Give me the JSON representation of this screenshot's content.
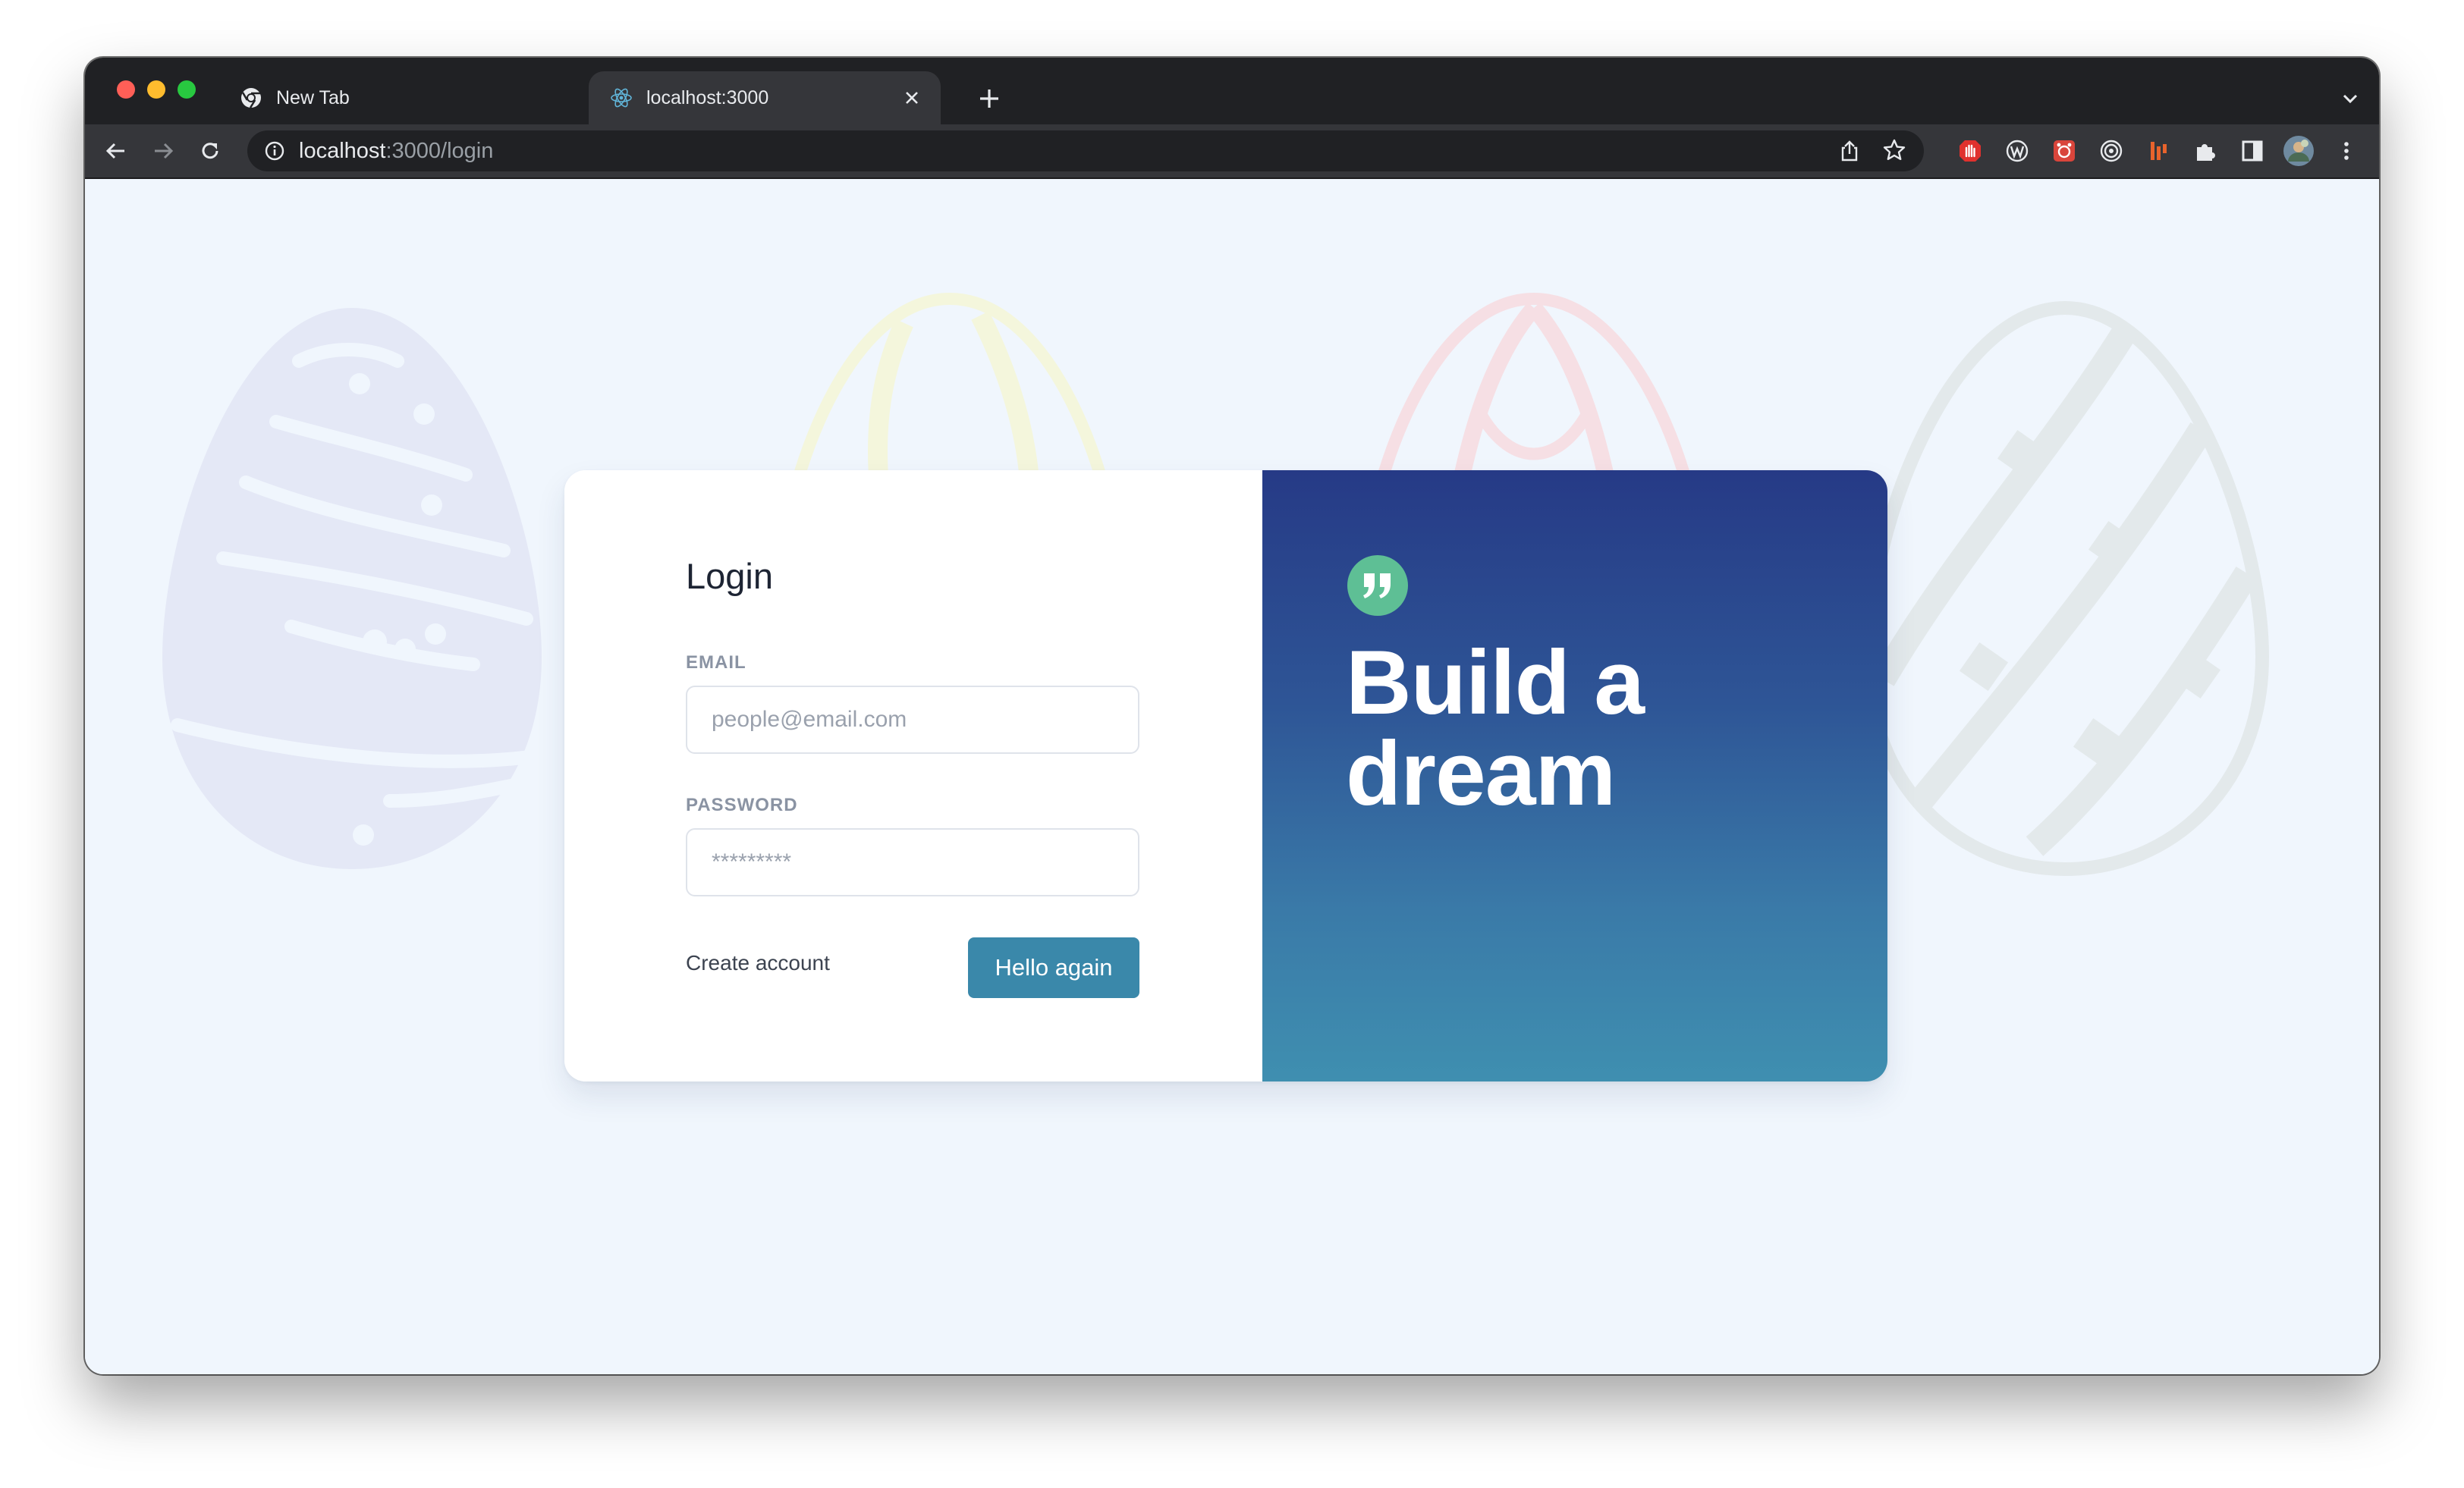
{
  "browser": {
    "tabs": [
      {
        "label": "New Tab",
        "icon": "chrome-icon",
        "active": false
      },
      {
        "label": "localhost:3000",
        "icon": "react-icon",
        "active": true
      }
    ],
    "url_host": "localhost",
    "url_rest": ":3000/login"
  },
  "login": {
    "title": "Login",
    "email_label": "EMAIL",
    "email_placeholder": "people@email.com",
    "password_label": "PASSWORD",
    "password_placeholder": "*********",
    "create_account": "Create account",
    "submit_label": "Hello again"
  },
  "hero": {
    "line1": "Build a",
    "line2": "dream",
    "quote_icon": "quote-icon"
  },
  "colors": {
    "accent_button": "#3a88aa",
    "hero_gradient_top": "#263a86",
    "hero_gradient_bottom": "#3f8fb0",
    "quote_badge": "#5ebf95",
    "page_background": "#f0f6fd"
  }
}
